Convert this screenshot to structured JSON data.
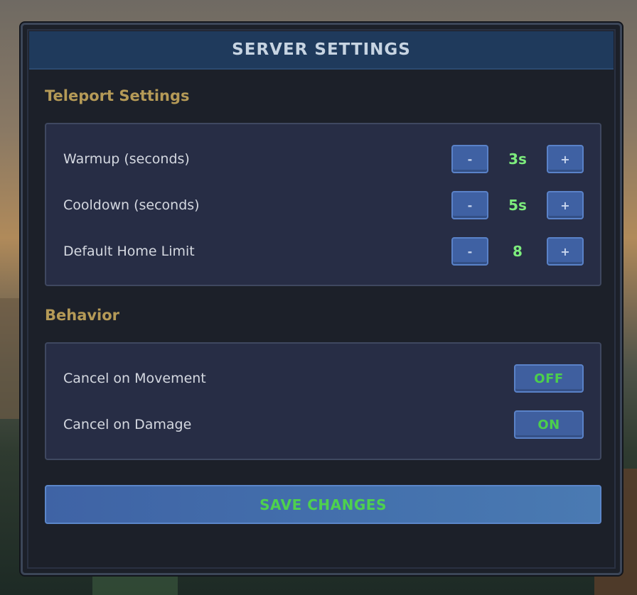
{
  "dialog": {
    "title": "SERVER SETTINGS"
  },
  "teleport": {
    "heading": "Teleport Settings",
    "rows": [
      {
        "label": "Warmup (seconds)",
        "minus": "-",
        "value": "3s",
        "plus": "+"
      },
      {
        "label": "Cooldown (seconds)",
        "minus": "-",
        "value": "5s",
        "plus": "+"
      },
      {
        "label": "Default Home Limit",
        "minus": "-",
        "value": "8",
        "plus": "+"
      }
    ]
  },
  "behavior": {
    "heading": "Behavior",
    "rows": [
      {
        "label": "Cancel on Movement",
        "toggle": "OFF"
      },
      {
        "label": "Cancel on Damage",
        "toggle": "ON"
      }
    ]
  },
  "save": {
    "label": "SAVE CHANGES"
  },
  "colors": {
    "title_bar": "#1f3a5c",
    "heading": "#b59a57",
    "value_green": "#7dec7d",
    "button_blue": "#3f61a3"
  }
}
